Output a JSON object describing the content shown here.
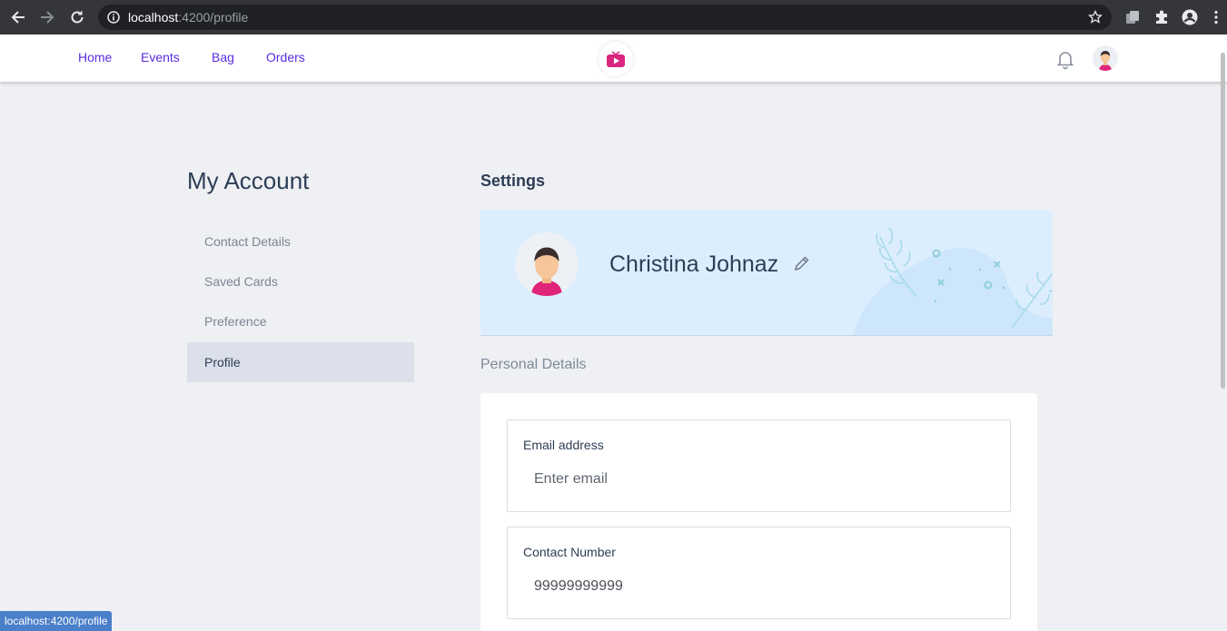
{
  "browser": {
    "url_host": "localhost",
    "url_rest": ":4200/profile",
    "status_url": "localhost:4200/profile"
  },
  "nav": {
    "links": [
      "Home",
      "Events",
      "Bag",
      "Orders"
    ]
  },
  "sidebar": {
    "title": "My Account",
    "items": [
      {
        "label": "Contact Details",
        "active": false
      },
      {
        "label": "Saved Cards",
        "active": false
      },
      {
        "label": "Preference",
        "active": false
      },
      {
        "label": "Profile",
        "active": true
      }
    ]
  },
  "settings": {
    "title": "Settings",
    "user_name": "Christina Johnaz",
    "section_label": "Personal Details",
    "fields": [
      {
        "label": "Email address",
        "value": "",
        "placeholder": "Enter email"
      },
      {
        "label": "Contact Number",
        "value": "99999999999",
        "placeholder": ""
      }
    ]
  },
  "colors": {
    "accent": "#5b2be0",
    "logo": "#d9267e",
    "banner": "#dceefe"
  }
}
